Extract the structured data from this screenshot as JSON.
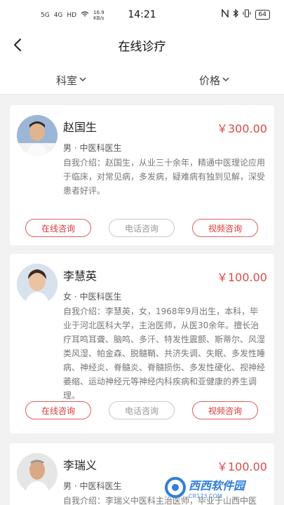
{
  "status": {
    "network": [
      "5G",
      "4G",
      "HD",
      "16.9"
    ],
    "speed_unit": "KB/s",
    "time": "14:21",
    "battery": "64"
  },
  "nav": {
    "title": "在线诊疗"
  },
  "filters": [
    {
      "label": "科室"
    },
    {
      "label": "价格"
    }
  ],
  "doctors": [
    {
      "name": "赵国生",
      "price": "￥300.00",
      "title": "男 · 中医科医生",
      "intro": "自我介绍：赵国生，从业三十余年，精通中医理论应用于临床，对常见病，多发病，疑难病有独到见解，深受患者好评。"
    },
    {
      "name": "李慧英",
      "price": "￥100.00",
      "title": "女 · 中医科医生",
      "intro": "自我介绍：李慧英，女，1968年9月出生，本科，毕业于河北医科大学，主治医师，从医30余年。擅长治疗耳鸣耳聋、脑鸣、多汗、特发性震颤、斯蒂尔、风湿类风湿、帕金森、脱髓鞘、共济失调、失眠、多发性睡病、神经炎、脊髓炎、脊髓损伤、多发性硬化、视神经萎缩、运动神经元等神经内科疾病和亚健康的养生调理。"
    },
    {
      "name": "李瑞义",
      "price": "￥100.00",
      "title": "男 · 中医科医生",
      "intro": "自我介绍：李瑞义中医科主治医师，毕业于山西中医"
    }
  ],
  "buttons": {
    "online": "在线咨询",
    "phone": "电话咨询",
    "video": "视频咨询"
  },
  "watermark": {
    "text": "西西软件园",
    "sub": "CR173.COM"
  },
  "colors": {
    "accent": "#e04848",
    "background": "#f2f2f2"
  }
}
